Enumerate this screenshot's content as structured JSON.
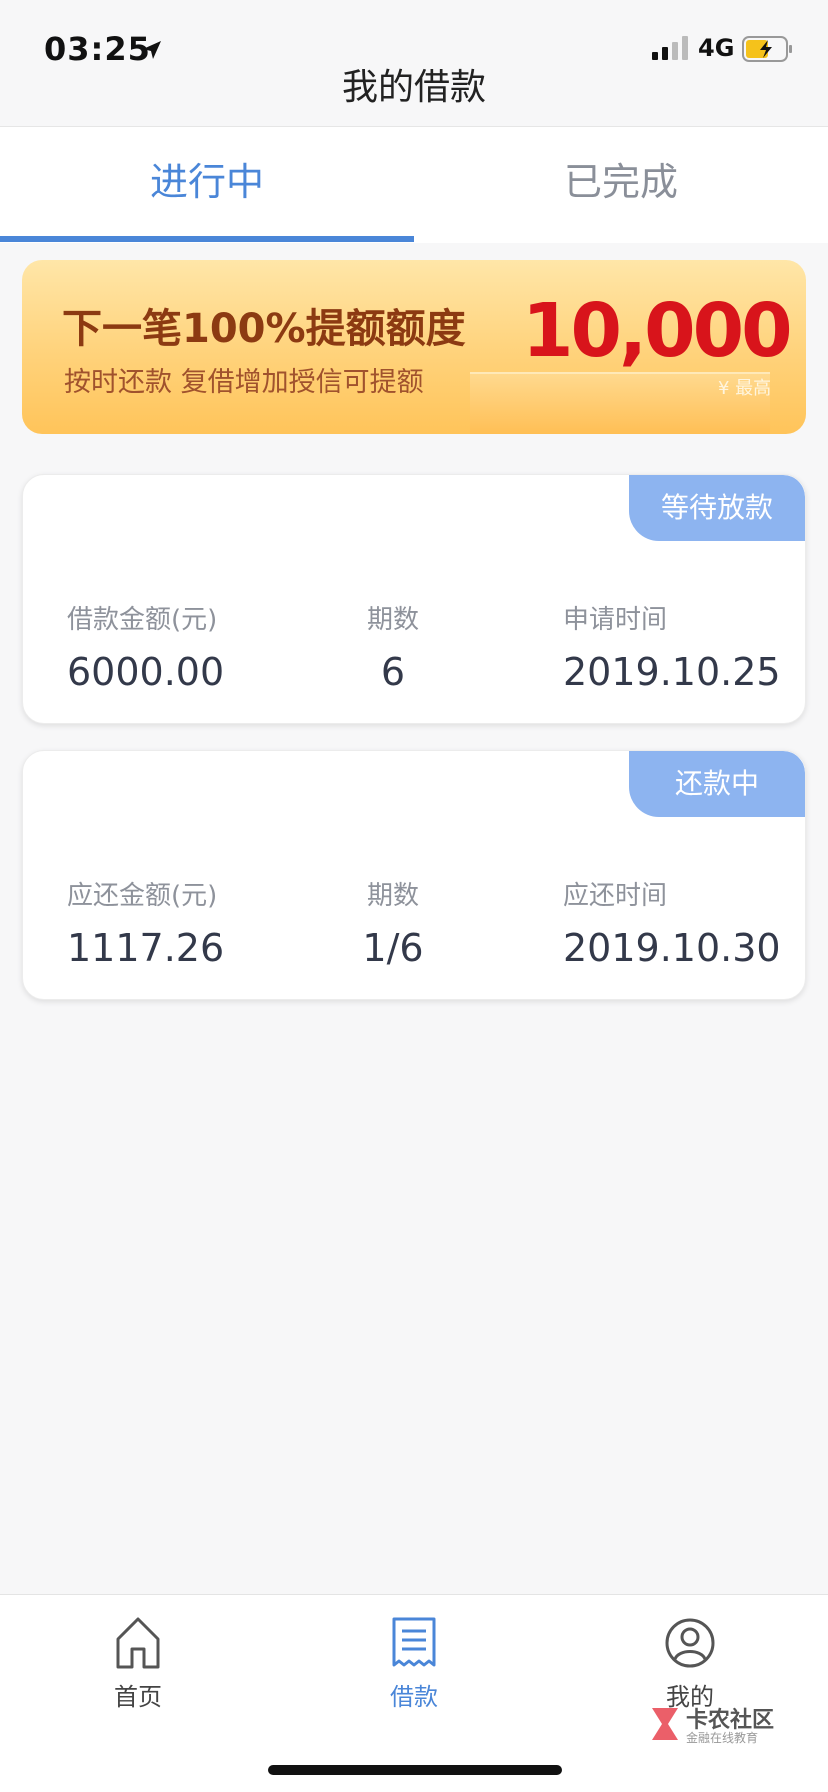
{
  "status_bar": {
    "time": "03:25",
    "network": "4G",
    "icons": [
      "location-arrow-icon",
      "signal-icon",
      "battery-charging-icon"
    ]
  },
  "header": {
    "title": "我的借款"
  },
  "tabs": [
    {
      "label": "进行中",
      "active": true
    },
    {
      "label": "已完成",
      "active": false
    }
  ],
  "banner": {
    "headline": "下一笔100%提额额度",
    "subtext": "按时还款  复借增加授信可提额",
    "amount": "10,000",
    "tag": "¥ 最高"
  },
  "loans": [
    {
      "status": "等待放款",
      "col1_label": "借款金额(元)",
      "col1_value": "6000.00",
      "col2_label": "期数",
      "col2_value": "6",
      "col3_label": "申请时间",
      "col3_value": "2019.10.25"
    },
    {
      "status": "还款中",
      "col1_label": "应还金额(元)",
      "col1_value": "1117.26",
      "col2_label": "期数",
      "col2_value": "1/6",
      "col3_label": "应还时间",
      "col3_value": "2019.10.30"
    }
  ],
  "bottom_nav": [
    {
      "label": "首页",
      "icon": "home-icon",
      "active": false
    },
    {
      "label": "借款",
      "icon": "document-icon",
      "active": true
    },
    {
      "label": "我的",
      "icon": "user-icon",
      "active": false
    }
  ],
  "watermark": {
    "text": "卡农社区",
    "subtext": "金融在线教育"
  },
  "colors": {
    "accent": "#4a86d8",
    "badge": "#8db4f0",
    "banner_amount": "#d8141b"
  }
}
